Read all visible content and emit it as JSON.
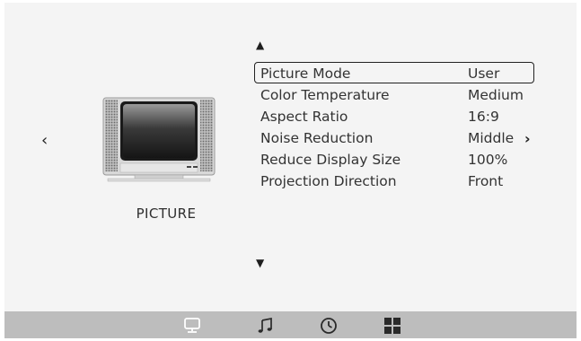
{
  "category": {
    "label": "PICTURE"
  },
  "menu": {
    "items": [
      {
        "label": "Picture Mode",
        "value": "User",
        "selected": true
      },
      {
        "label": "Color Temperature",
        "value": "Medium"
      },
      {
        "label": "Aspect Ratio",
        "value": "16:9"
      },
      {
        "label": "Noise Reduction",
        "value": "Middle",
        "submenu": true
      },
      {
        "label": "Reduce Display Size",
        "value": "100%"
      },
      {
        "label": "Projection Direction",
        "value": "Front"
      }
    ]
  },
  "nav": {
    "left": "‹",
    "right": "›",
    "up": "▲",
    "down": "▼"
  },
  "taskbar": {
    "icons": [
      "monitor-icon",
      "music-note-icon",
      "clock-icon",
      "apps-grid-icon"
    ]
  },
  "colors": {
    "background": "#f4f4f4",
    "taskbar": "#bdbdbd",
    "text": "#333333"
  }
}
